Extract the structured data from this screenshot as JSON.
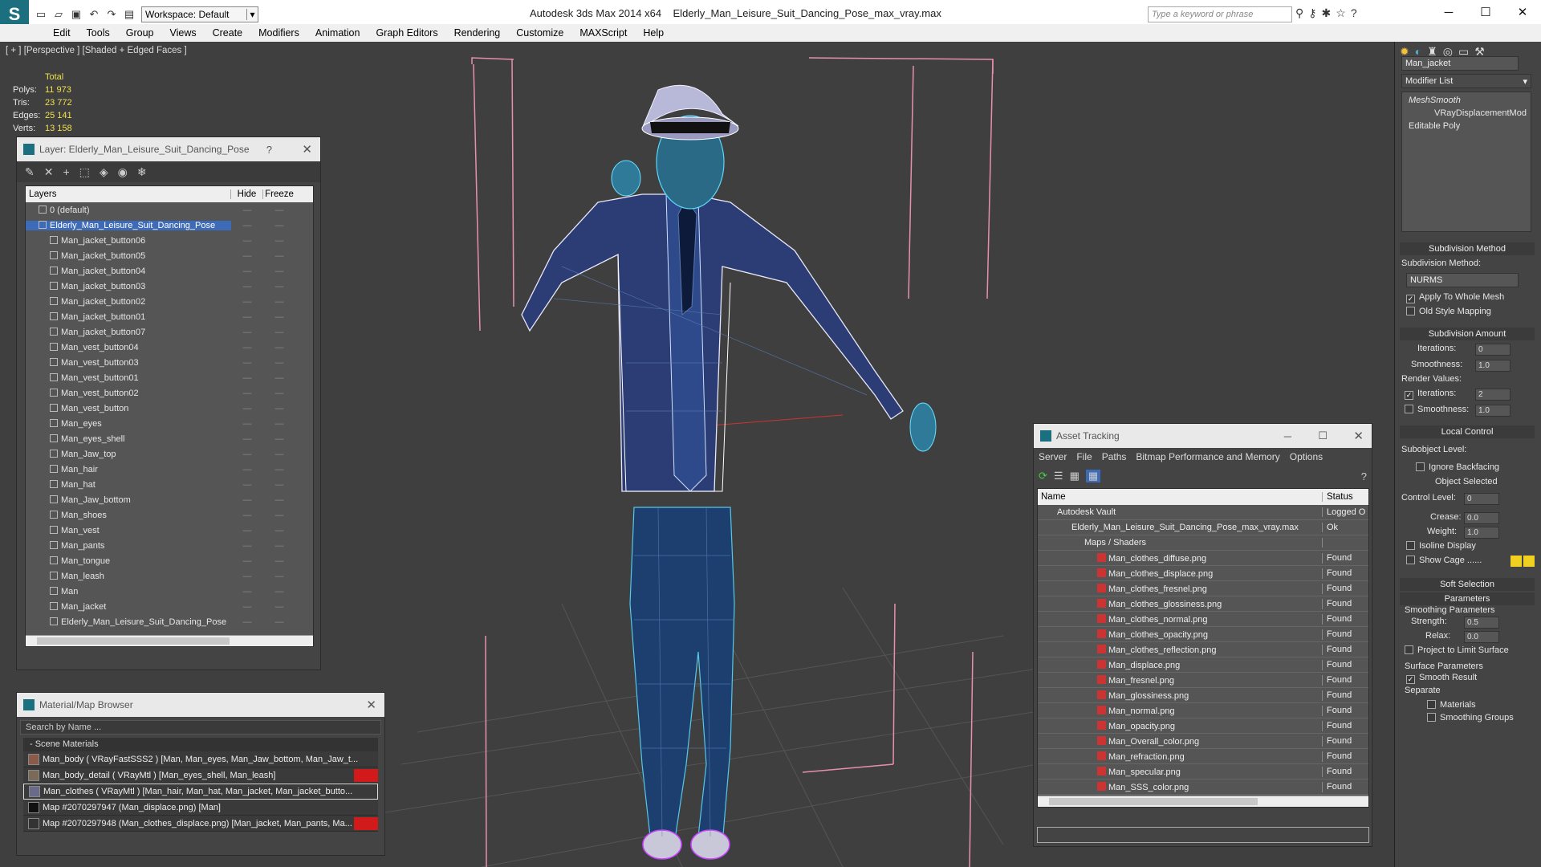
{
  "app": {
    "workspace": "Workspace: Default",
    "title": "Autodesk 3ds Max  2014 x64",
    "file": "Elderly_Man_Leisure_Suit_Dancing_Pose_max_vray.max",
    "search_placeholder": "Type a keyword or phrase"
  },
  "menu": [
    "Edit",
    "Tools",
    "Group",
    "Views",
    "Create",
    "Modifiers",
    "Animation",
    "Graph Editors",
    "Rendering",
    "Customize",
    "MAXScript",
    "Help"
  ],
  "viewport": {
    "label": "[ + ] [Perspective ] [Shaded + Edged Faces ]",
    "stats": {
      "total": "Total",
      "rows": [
        {
          "k": "Polys:",
          "v": "11 973"
        },
        {
          "k": "Tris:",
          "v": "23 772"
        },
        {
          "k": "Edges:",
          "v": "25 141"
        },
        {
          "k": "Verts:",
          "v": "13 158"
        }
      ]
    }
  },
  "layer": {
    "title": "Layer: Elderly_Man_Leisure_Suit_Dancing_Pose",
    "help": "?",
    "cols": [
      "Layers",
      "Hide",
      "Freeze"
    ],
    "rows": [
      "0 (default)",
      "Elderly_Man_Leisure_Suit_Dancing_Pose",
      "Man_jacket_button06",
      "Man_jacket_button05",
      "Man_jacket_button04",
      "Man_jacket_button03",
      "Man_jacket_button02",
      "Man_jacket_button01",
      "Man_jacket_button07",
      "Man_vest_button04",
      "Man_vest_button03",
      "Man_vest_button01",
      "Man_vest_button02",
      "Man_vest_button",
      "Man_eyes",
      "Man_eyes_shell",
      "Man_Jaw_top",
      "Man_hair",
      "Man_hat",
      "Man_Jaw_bottom",
      "Man_shoes",
      "Man_vest",
      "Man_pants",
      "Man_tongue",
      "Man_leash",
      "Man",
      "Man_jacket",
      "Elderly_Man_Leisure_Suit_Dancing_Pose"
    ]
  },
  "material": {
    "title": "Material/Map Browser",
    "search": "Search by Name ...",
    "section": "- Scene Materials",
    "rows": [
      "Man_body  ( VRayFastSSS2 ) [Man, Man_eyes, Man_Jaw_bottom, Man_Jaw_t...",
      "Man_body_detail  ( VRayMtl ) [Man_eyes_shell, Man_leash]",
      "Man_clothes  ( VRayMtl ) [Man_hair, Man_hat, Man_jacket, Man_jacket_butto...",
      "Map #2070297947 (Man_displace.png) [Man]",
      "Map #2070297948 (Man_clothes_displace.png) [Man_jacket, Man_pants, Ma..."
    ]
  },
  "asset": {
    "title": "Asset Tracking",
    "menu": [
      "Server",
      "File",
      "Paths",
      "Bitmap Performance and Memory",
      "Options"
    ],
    "cols": [
      "Name",
      "Status"
    ],
    "vault": {
      "name": "Autodesk Vault",
      "status": "Logged O"
    },
    "file": {
      "name": "Elderly_Man_Leisure_Suit_Dancing_Pose_max_vray.max",
      "status": "Ok"
    },
    "maps": "Maps / Shaders",
    "rows": [
      {
        "n": "Man_clothes_diffuse.png",
        "s": "Found"
      },
      {
        "n": "Man_clothes_displace.png",
        "s": "Found"
      },
      {
        "n": "Man_clothes_fresnel.png",
        "s": "Found"
      },
      {
        "n": "Man_clothes_glossiness.png",
        "s": "Found"
      },
      {
        "n": "Man_clothes_normal.png",
        "s": "Found"
      },
      {
        "n": "Man_clothes_opacity.png",
        "s": "Found"
      },
      {
        "n": "Man_clothes_reflection.png",
        "s": "Found"
      },
      {
        "n": "Man_displace.png",
        "s": "Found"
      },
      {
        "n": "Man_fresnel.png",
        "s": "Found"
      },
      {
        "n": "Man_glossiness.png",
        "s": "Found"
      },
      {
        "n": "Man_normal.png",
        "s": "Found"
      },
      {
        "n": "Man_opacity.png",
        "s": "Found"
      },
      {
        "n": "Man_Overall_color.png",
        "s": "Found"
      },
      {
        "n": "Man_refraction.png",
        "s": "Found"
      },
      {
        "n": "Man_specular.png",
        "s": "Found"
      },
      {
        "n": "Man_SSS_color.png",
        "s": "Found"
      }
    ]
  },
  "cmd": {
    "object": "Man_jacket",
    "modlist": "Modifier List",
    "stack": [
      "MeshSmooth",
      "VRayDisplacementMod",
      "Editable Poly"
    ],
    "subdiv_method_title": "Subdivision Method",
    "subdiv_method_label": "Subdivision Method:",
    "subdiv_method": "NURMS",
    "apply_whole": "Apply To Whole Mesh",
    "old_style": "Old Style Mapping",
    "subdiv_amount": "Subdivision Amount",
    "iterations": "Iterations:",
    "iter_val": "0",
    "smoothness": "Smoothness:",
    "smooth_val": "1.0",
    "render_values": "Render Values:",
    "r_iter_val": "2",
    "r_smooth_val": "1.0",
    "local_control": "Local Control",
    "subobject": "Subobject Level:",
    "ignore_backfacing": "Ignore Backfacing",
    "object_selected": "Object Selected",
    "control_level": "Control Level:",
    "control_val": "0",
    "crease": "Crease:",
    "crease_val": "0.0",
    "weight": "Weight:",
    "weight_val": "1.0",
    "isoline": "Isoline Display",
    "show_cage": "Show Cage ......",
    "soft_selection": "Soft Selection",
    "parameters": "Parameters",
    "smoothing_params": "Smoothing Parameters",
    "strength": "Strength:",
    "strength_val": "0.5",
    "relax": "Relax:",
    "relax_val": "0.0",
    "project": "Project to Limit Surface",
    "surface_params": "Surface Parameters",
    "smooth_result": "Smooth Result",
    "separate": "Separate",
    "materials": "Materials",
    "smoothing_groups": "Smoothing Groups"
  }
}
